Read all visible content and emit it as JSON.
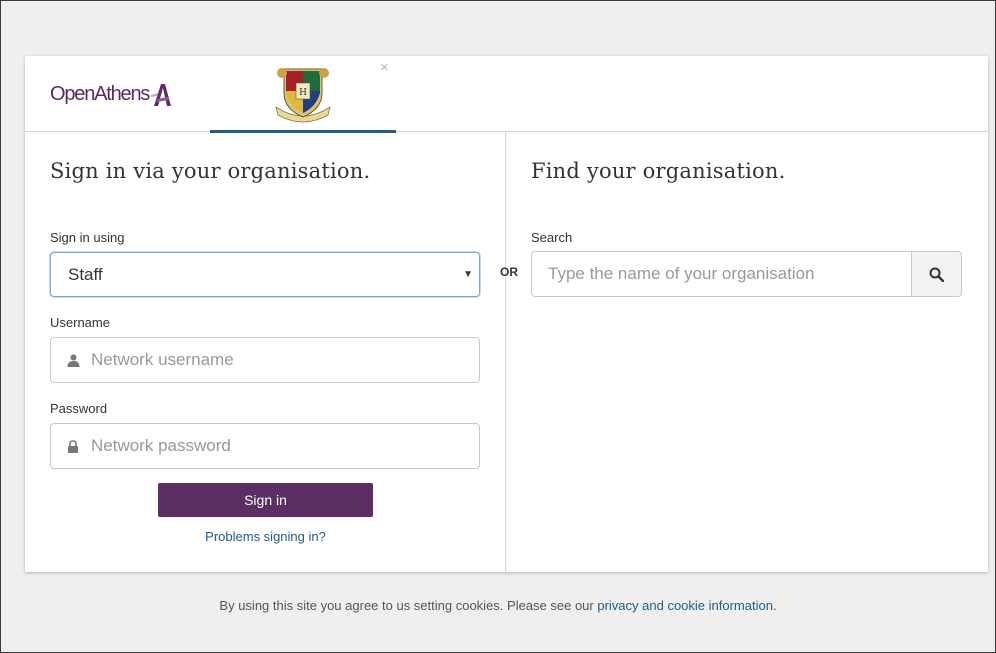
{
  "tabs": {
    "brand": "OpenAthens",
    "close_symbol": "×"
  },
  "left": {
    "heading": "Sign in via your organisation.",
    "sign_in_using_label": "Sign in using",
    "sign_in_using_value": "Staff",
    "username_label": "Username",
    "username_placeholder": "Network username",
    "password_label": "Password",
    "password_placeholder": "Network password",
    "sign_in_button": "Sign in",
    "problems_link": "Problems signing in?"
  },
  "or_label": "OR",
  "right": {
    "heading": "Find your organisation.",
    "search_label": "Search",
    "search_placeholder": "Type the name of your organisation"
  },
  "footer": {
    "text": "By using this site you agree to us setting cookies. Please see our ",
    "link": "privacy and cookie information",
    "suffix": "."
  },
  "colors": {
    "brand_purple": "#5b2f63",
    "link_blue": "#1f5c8b",
    "tab_underline": "#1f5c8b"
  },
  "icons": {
    "user_field": "user-icon",
    "password_field": "lock-icon",
    "search_button": "search-icon",
    "select_caret": "caret-down-icon",
    "org_tab": "crest-icon"
  }
}
